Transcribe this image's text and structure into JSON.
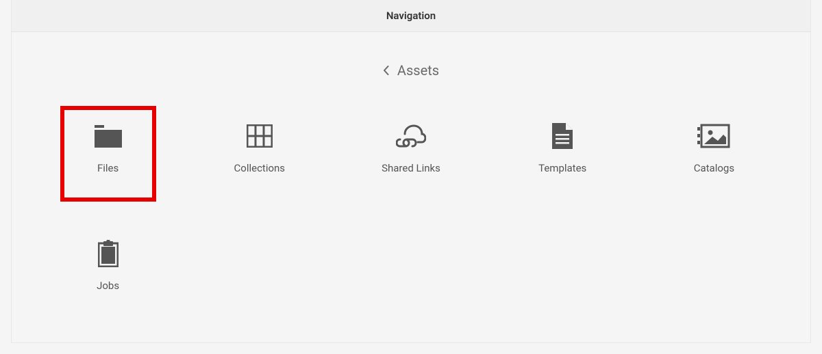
{
  "header": {
    "title": "Navigation"
  },
  "breadcrumb": {
    "label": "Assets"
  },
  "tiles": [
    {
      "label": "Files",
      "highlighted": true
    },
    {
      "label": "Collections",
      "highlighted": false
    },
    {
      "label": "Shared Links",
      "highlighted": false
    },
    {
      "label": "Templates",
      "highlighted": false
    },
    {
      "label": "Catalogs",
      "highlighted": false
    },
    {
      "label": "Jobs",
      "highlighted": false
    }
  ]
}
